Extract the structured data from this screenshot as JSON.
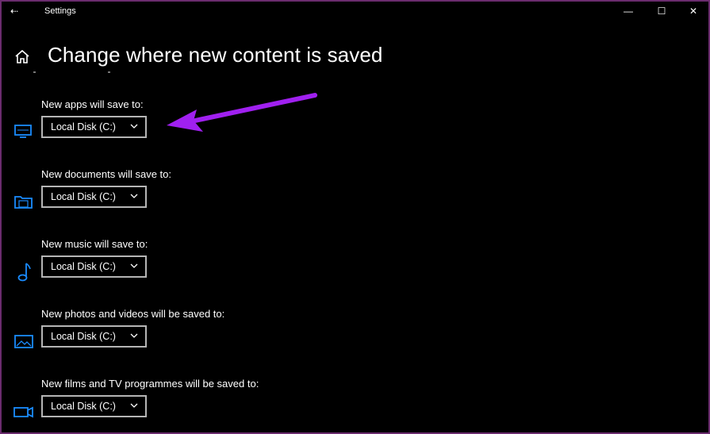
{
  "window": {
    "title": "Settings",
    "controls": {
      "minimize": "—",
      "maximize": "☐",
      "close": "✕"
    },
    "back_glyph": "⇠"
  },
  "page": {
    "title": "Change where new content is saved"
  },
  "sections": [
    {
      "label": "New apps will save to:",
      "value": "Local Disk (C:)",
      "icon": "monitor-icon"
    },
    {
      "label": "New documents will save to:",
      "value": "Local Disk (C:)",
      "icon": "document-folder-icon"
    },
    {
      "label": "New music will save to:",
      "value": "Local Disk (C:)",
      "icon": "music-note-icon"
    },
    {
      "label": "New photos and videos will be saved to:",
      "value": "Local Disk (C:)",
      "icon": "picture-icon"
    },
    {
      "label": "New films and TV programmes will be saved to:",
      "value": "Local Disk (C:)",
      "icon": "video-camera-icon"
    }
  ],
  "colors": {
    "background": "#000000",
    "accent_icon": "#1a8cff",
    "annotation_arrow": "#a020f0",
    "window_border": "#6b2c6e"
  }
}
